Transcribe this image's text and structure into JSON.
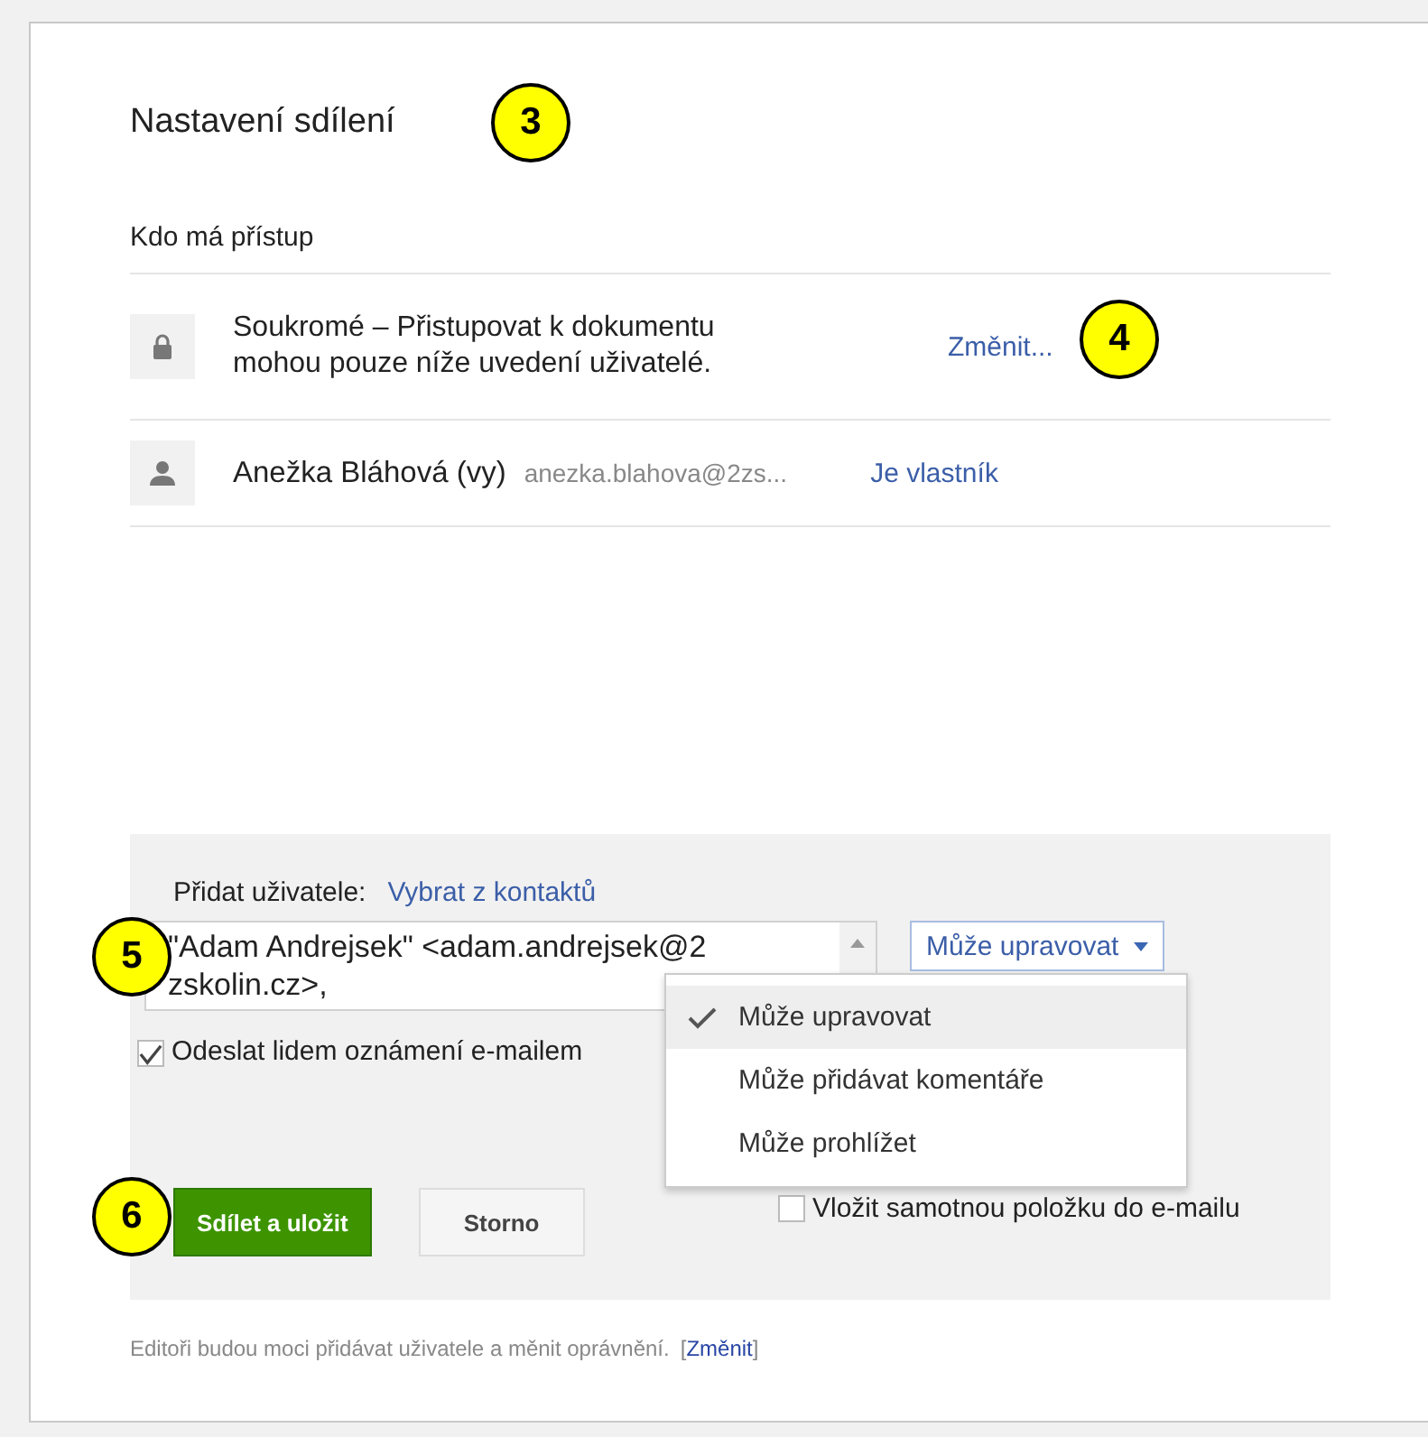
{
  "title": "Nastavení sdílení",
  "access": {
    "heading": "Kdo má přístup",
    "rows": [
      {
        "kind": "visibility",
        "text": "Soukromé – Přistupovat k dokumentu mohou pouze níže uvedení uživatelé.",
        "action": "Změnit..."
      },
      {
        "kind": "person",
        "name": "Anežka Bláhová (vy)",
        "email": "anezka.blahova@2zs...",
        "action": "Je vlastník"
      }
    ]
  },
  "add_people": {
    "label": "Přidat uživatele:",
    "contacts_link": "Vybrat z kontaktů",
    "value": "\"Adam Andrejsek\" <adam.andrejsek@2zskolin.cz>,",
    "permission": "Může upravovat",
    "menu": [
      {
        "label": "Může upravovat",
        "selected": true
      },
      {
        "label": "Může přidávat komentáře",
        "selected": false
      },
      {
        "label": "Může prohlížet",
        "selected": false
      }
    ],
    "options": [
      {
        "label": "Odeslat lidem oznámení e-mailem",
        "checked": true
      },
      {
        "label": "Vložit samotnou položku do e-mailu",
        "checked": false
      }
    ],
    "buttons": [
      {
        "label": "Sdílet a uložit",
        "kind": "primary"
      },
      {
        "label": "Storno",
        "kind": "secondary"
      }
    ]
  },
  "footer": {
    "text": "Editoři budou moci přidávat uživatele a měnit oprávnění.",
    "open": "[",
    "link": "Změnit",
    "close": "]"
  },
  "callouts": [
    "3",
    "4",
    "5",
    "6"
  ]
}
